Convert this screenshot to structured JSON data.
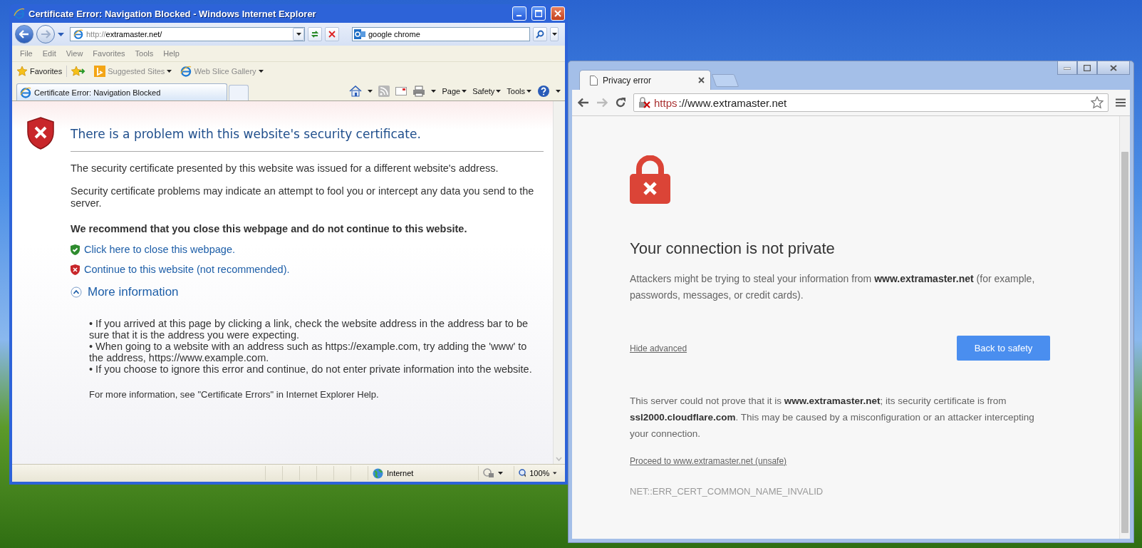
{
  "ie_window": {
    "title": "Certificate Error: Navigation Blocked - Windows Internet Explorer",
    "address": {
      "scheme": "http://",
      "rest": "extramaster.net/"
    },
    "search": {
      "value": "google chrome"
    },
    "menu": [
      "File",
      "Edit",
      "View",
      "Favorites",
      "Tools",
      "Help"
    ],
    "favorites_bar": {
      "label": "Favorites",
      "items": [
        "Suggested Sites",
        "Web Slice Gallery"
      ]
    },
    "tabs": [
      {
        "label": "Certificate Error: Navigation Blocked",
        "selected": true
      }
    ],
    "command_bar": [
      "Page",
      "Safety",
      "Tools"
    ],
    "content": {
      "heading": "There is a problem with this website's security certificate.",
      "paragraphs": [
        "The security certificate presented by this website was issued for a different website's address.",
        "Security certificate problems may indicate an attempt to fool you or intercept any data you send to the server."
      ],
      "recommendation": "We recommend that you close this webpage and do not continue to this website.",
      "links": [
        {
          "kind": "safe",
          "text": "Click here to close this webpage."
        },
        {
          "kind": "unsafe",
          "text": "Continue to this website (not recommended)."
        }
      ],
      "more_information": {
        "label": "More information",
        "expanded": true,
        "bullets": [
          "•  If you arrived at this page by clicking a link, check the website address in the address bar to be sure that it is the address you were expecting.",
          "•  When going to a website with an address such as https://example.com, try adding the 'www' to the address, https://www.example.com.",
          "•  If you choose to ignore this error and continue, do not enter private information into the website."
        ]
      },
      "footer": "For more information, see \"Certificate Errors\" in Internet Explorer Help."
    },
    "status_bar": {
      "zone": "Internet",
      "zoom": "100%"
    }
  },
  "chrome_window": {
    "tabs": [
      {
        "label": "Privacy error",
        "selected": true
      }
    ],
    "url": {
      "scheme": "https",
      "rest": "://www.extramaster.net"
    },
    "content": {
      "heading": "Your connection is not private",
      "description": "Attackers might be trying to steal your information from **www.extramaster.net** (for example, passwords, messages, or credit cards).",
      "hide_advanced": "Hide advanced",
      "back_button": "Back to safety",
      "details": "This server could not prove that it is **www.extramaster.net**; its security certificate is from **ssl2000.cloudflare.com**. This may be caused by a misconfiguration or an attacker intercepting your connection.",
      "proceed_link": "Proceed to www.extramaster.net (unsafe)",
      "error_code": "NET::ERR_CERT_COMMON_NAME_INVALID"
    }
  }
}
